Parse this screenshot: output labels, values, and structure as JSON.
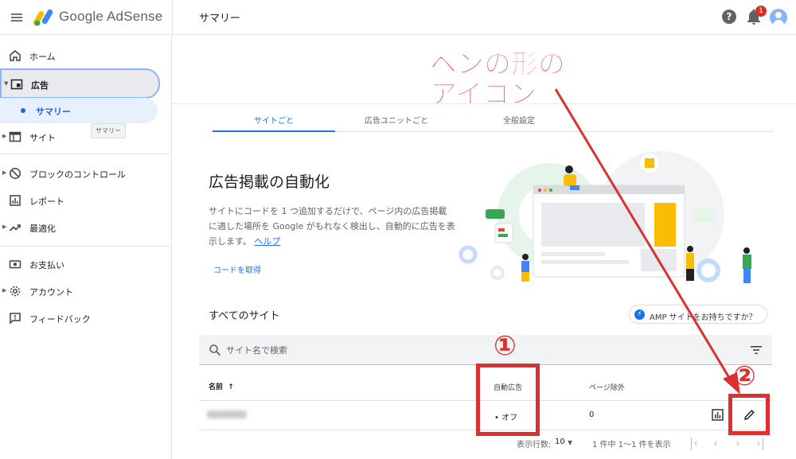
{
  "header": {
    "brand": "Google AdSense",
    "page_title": "サマリー",
    "help_glyph": "?",
    "notification_count": "1"
  },
  "sidebar": {
    "items": [
      {
        "label": "ホーム",
        "icon": "home-icon"
      },
      {
        "label": "広告",
        "icon": "ads-icon"
      },
      {
        "label": "サマリー",
        "icon": "dot"
      },
      {
        "label": "サイト",
        "icon": "sites-icon"
      },
      {
        "label": "ブロックのコントロール",
        "icon": "block-icon"
      },
      {
        "label": "レポート",
        "icon": "report-icon"
      },
      {
        "label": "最適化",
        "icon": "trending-icon"
      },
      {
        "label": "お支払い",
        "icon": "payment-icon"
      },
      {
        "label": "アカウント",
        "icon": "gear-icon"
      },
      {
        "label": "フィードバック",
        "icon": "feedback-icon"
      }
    ],
    "tooltip": "サマリー"
  },
  "tabs": [
    "サイトごと",
    "広告ユニットごと",
    "全般設定"
  ],
  "hero": {
    "title": "広告掲載の自動化",
    "description": "サイトにコードを 1 つ追加するだけで、ページ内の広告掲載に適した場所を Google がもれなく検出し、自動的に広告を表示します。",
    "help_link": "ヘルプ",
    "get_code": "コードを取得"
  },
  "sites": {
    "heading": "すべてのサイト",
    "amp_chip": "AMP サイトをお持ちですか？",
    "search_placeholder": "サイト名で検索",
    "columns": {
      "name": "名前",
      "sort_glyph": "↑",
      "auto_ads": "自動広告",
      "page_exclusions": "ページ除外"
    },
    "rows": [
      {
        "auto_ads": "オフ",
        "page_exclusions": "0"
      }
    ]
  },
  "pagination": {
    "rows_per_page_label": "表示行数:",
    "rows_per_page": "10",
    "range": "1 件中 1〜1 件を表示"
  },
  "annotations": {
    "callout_line1": "ペンの形の",
    "callout_line2": "アイコン",
    "marker1": "①",
    "marker2": "②",
    "color": "#d93030"
  },
  "colors": {
    "accent": "#1a73e8",
    "selected_bg": "#e8f0fe"
  }
}
